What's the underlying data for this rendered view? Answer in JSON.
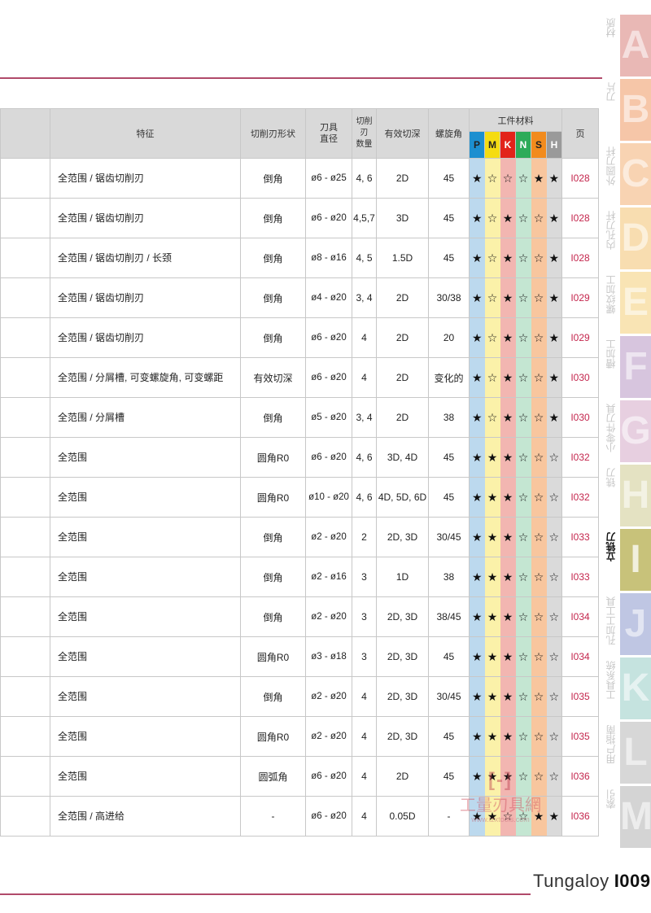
{
  "table": {
    "headers": {
      "feature": "特征",
      "shape": "切削刃形状",
      "diameter": "刀具\n直径",
      "flutes": "切削刃\n数量",
      "depth": "有效切深",
      "helix": "螺旋角",
      "materials_group": "工件材料",
      "page": "页",
      "materials": [
        "P",
        "M",
        "K",
        "N",
        "S",
        "H"
      ]
    },
    "rows": [
      {
        "feature": "全范围 / 锯齿切削刃",
        "shape": "倒角",
        "diameter": "ø6 - ø25",
        "flutes": "4, 6",
        "depth": "2D",
        "helix": "45",
        "ratings": [
          "★",
          "☆",
          "☆",
          "☆",
          "★",
          "★"
        ],
        "page": "I028"
      },
      {
        "feature": "全范围 / 锯齿切削刃",
        "shape": "倒角",
        "diameter": "ø6 - ø20",
        "flutes": "4,5,7",
        "depth": "3D",
        "helix": "45",
        "ratings": [
          "★",
          "☆",
          "★",
          "☆",
          "☆",
          "★"
        ],
        "page": "I028"
      },
      {
        "feature": "全范围 / 锯齿切削刃 /\n长颈",
        "shape": "倒角",
        "diameter": "ø8 - ø16",
        "flutes": "4, 5",
        "depth": "1.5D",
        "helix": "45",
        "ratings": [
          "★",
          "☆",
          "★",
          "☆",
          "☆",
          "★"
        ],
        "page": "I028"
      },
      {
        "feature": "全范围 / 锯齿切削刃",
        "shape": "倒角",
        "diameter": "ø4 - ø20",
        "flutes": "3, 4",
        "depth": "2D",
        "helix": "30/38",
        "ratings": [
          "★",
          "☆",
          "★",
          "☆",
          "☆",
          "★"
        ],
        "page": "I029"
      },
      {
        "feature": "全范围 / 锯齿切削刃",
        "shape": "倒角",
        "diameter": "ø6 - ø20",
        "flutes": "4",
        "depth": "2D",
        "helix": "20",
        "ratings": [
          "★",
          "☆",
          "★",
          "☆",
          "☆",
          "★"
        ],
        "page": "I029"
      },
      {
        "feature": "全范围 /\n分屑槽, 可变螺旋角, 可变螺距",
        "shape": "有效切深",
        "diameter": "ø6 - ø20",
        "flutes": "4",
        "depth": "2D",
        "helix": "变化的",
        "ratings": [
          "★",
          "☆",
          "★",
          "☆",
          "☆",
          "★"
        ],
        "page": "I030"
      },
      {
        "feature": "全范围 / 分屑槽",
        "shape": "倒角",
        "diameter": "ø5 - ø20",
        "flutes": "3, 4",
        "depth": "2D",
        "helix": "38",
        "ratings": [
          "★",
          "☆",
          "★",
          "☆",
          "☆",
          "★"
        ],
        "page": "I030"
      },
      {
        "feature": "全范围",
        "shape": "圆角R0",
        "diameter": "ø6 - ø20",
        "flutes": "4, 6",
        "depth": "3D, 4D",
        "helix": "45",
        "ratings": [
          "★",
          "★",
          "★",
          "☆",
          "☆",
          "☆"
        ],
        "page": "I032"
      },
      {
        "feature": "全范围",
        "shape": "圆角R0",
        "diameter": "ø10 - ø20",
        "flutes": "4, 6",
        "depth": "4D, 5D, 6D",
        "helix": "45",
        "ratings": [
          "★",
          "★",
          "★",
          "☆",
          "☆",
          "☆"
        ],
        "page": "I032"
      },
      {
        "feature": "全范围",
        "shape": "倒角",
        "diameter": "ø2 - ø20",
        "flutes": "2",
        "depth": "2D, 3D",
        "helix": "30/45",
        "ratings": [
          "★",
          "★",
          "★",
          "☆",
          "☆",
          "☆"
        ],
        "page": "I033"
      },
      {
        "feature": "全范围",
        "shape": "倒角",
        "diameter": "ø2 - ø16",
        "flutes": "3",
        "depth": "1D",
        "helix": "38",
        "ratings": [
          "★",
          "★",
          "★",
          "☆",
          "☆",
          "☆"
        ],
        "page": "I033"
      },
      {
        "feature": "全范围",
        "shape": "倒角",
        "diameter": "ø2 - ø20",
        "flutes": "3",
        "depth": "2D, 3D",
        "helix": "38/45",
        "ratings": [
          "★",
          "★",
          "★",
          "☆",
          "☆",
          "☆"
        ],
        "page": "I034"
      },
      {
        "feature": "全范围",
        "shape": "圆角R0",
        "diameter": "ø3 - ø18",
        "flutes": "3",
        "depth": "2D, 3D",
        "helix": "45",
        "ratings": [
          "★",
          "★",
          "★",
          "☆",
          "☆",
          "☆"
        ],
        "page": "I034"
      },
      {
        "feature": "全范围",
        "shape": "倒角",
        "diameter": "ø2 - ø20",
        "flutes": "4",
        "depth": "2D, 3D",
        "helix": "30/45",
        "ratings": [
          "★",
          "★",
          "★",
          "☆",
          "☆",
          "☆"
        ],
        "page": "I035"
      },
      {
        "feature": "全范围",
        "shape": "圆角R0",
        "diameter": "ø2 - ø20",
        "flutes": "4",
        "depth": "2D, 3D",
        "helix": "45",
        "ratings": [
          "★",
          "★",
          "★",
          "☆",
          "☆",
          "☆"
        ],
        "page": "I035"
      },
      {
        "feature": "全范围",
        "shape": "圆弧角",
        "diameter": "ø6 - ø20",
        "flutes": "4",
        "depth": "2D",
        "helix": "45",
        "ratings": [
          "★",
          "★",
          "★",
          "☆",
          "☆",
          "☆"
        ],
        "page": "I036"
      },
      {
        "feature": "全范围 / 高进给",
        "shape": "-",
        "diameter": "ø6 - ø20",
        "flutes": "4",
        "depth": "0.05D",
        "helix": "-",
        "ratings": [
          "★",
          "★",
          "☆",
          "☆",
          "★",
          "★"
        ],
        "page": "I036"
      }
    ]
  },
  "side_tabs": [
    {
      "letter": "A",
      "label": "材质",
      "color": "#e9b8b5",
      "active": false
    },
    {
      "letter": "B",
      "label": "刀片",
      "color": "#f6c6a8",
      "active": false
    },
    {
      "letter": "C",
      "label": "外圆刀杆",
      "color": "#f8d3b2",
      "active": false
    },
    {
      "letter": "D",
      "label": "内孔刀杆",
      "color": "#f8ddb0",
      "active": false
    },
    {
      "letter": "E",
      "label": "螺纹加工",
      "color": "#f9e4b4",
      "active": false
    },
    {
      "letter": "F",
      "label": "槽加工",
      "color": "#d7c5de",
      "active": false
    },
    {
      "letter": "G",
      "label": "小零件刀具",
      "color": "#e7cfe0",
      "active": false
    },
    {
      "letter": "H",
      "label": "铣刀",
      "color": "#e4e2c2",
      "active": false
    },
    {
      "letter": "I",
      "label": "立铣刀",
      "color": "#c8c27a",
      "active": true
    },
    {
      "letter": "J",
      "label": "孔加工工具",
      "color": "#bfc6e3",
      "active": false
    },
    {
      "letter": "K",
      "label": "工具系统",
      "color": "#c5e3df",
      "active": false
    },
    {
      "letter": "L",
      "label": "用户指南",
      "color": "#d7d7d7",
      "active": false
    },
    {
      "letter": "M",
      "label": "索引",
      "color": "#d4d4d4",
      "active": false
    }
  ],
  "footer": {
    "brand": "Tungaloy",
    "page_number": "I009"
  },
  "watermark": {
    "mark": "[-]",
    "text": "工量刃具網",
    "url": "www.tzxtools.com"
  }
}
